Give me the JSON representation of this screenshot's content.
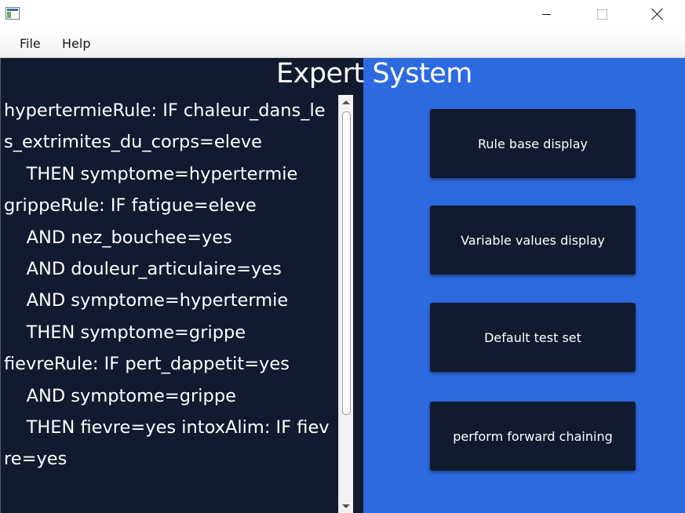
{
  "window": {
    "controls": {
      "minimize_icon": "minimize-icon",
      "maximize_icon": "maximize-icon",
      "close_icon": "close-icon"
    }
  },
  "menu": {
    "items": [
      {
        "label": "File"
      },
      {
        "label": "Help"
      }
    ]
  },
  "header": {
    "title": "Expert System"
  },
  "rules_text": "hypertermieRule: IF chaleur_dans_les_extrimites_du_corps=eleve\n    THEN symptome=hypertermie\ngrippeRule: IF fatigue=eleve\n    AND nez_bouchee=yes\n    AND douleur_articulaire=yes\n    AND symptome=hypertermie\n    THEN symptome=grippe\nfievreRule: IF pert_dappetit=yes\n    AND symptome=grippe\n    THEN fievre=yes intoxAlim: IF fievre=yes",
  "buttons": {
    "rule_base_display": "Rule base display",
    "variable_values_display": "Variable values display",
    "default_test_set": "Default test set",
    "perform_forward_chaining": "perform forward chaining"
  },
  "colors": {
    "left_pane_bg": "#111a2e",
    "right_pane_bg": "#2d6ae0",
    "button_bg": "#111a2e",
    "text": "#ffffff"
  }
}
